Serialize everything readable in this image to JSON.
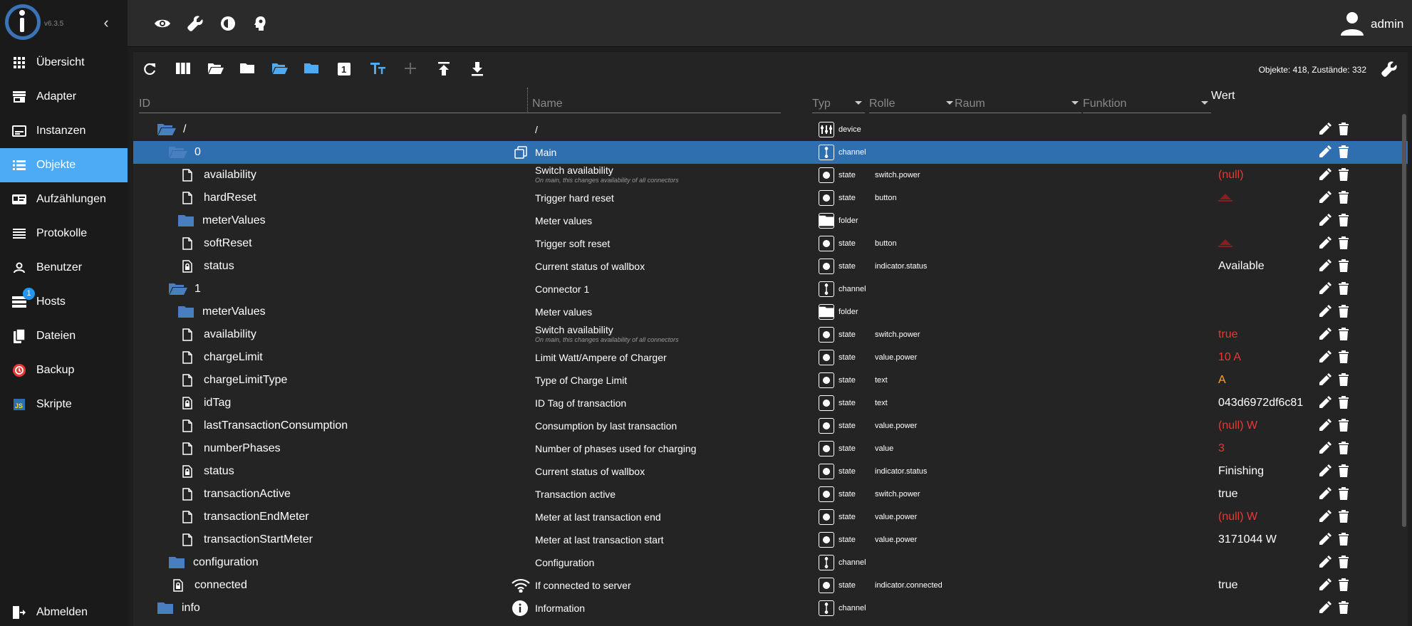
{
  "app": {
    "version": "v6.3.5"
  },
  "sidebar": {
    "items": [
      {
        "label": "Übersicht",
        "icon": "grid-icon"
      },
      {
        "label": "Adapter",
        "icon": "store-icon"
      },
      {
        "label": "Instanzen",
        "icon": "instances-icon"
      },
      {
        "label": "Objekte",
        "icon": "list-icon",
        "active": true
      },
      {
        "label": "Aufzählungen",
        "icon": "enum-icon"
      },
      {
        "label": "Protokolle",
        "icon": "log-icon"
      },
      {
        "label": "Benutzer",
        "icon": "user-icon"
      },
      {
        "label": "Hosts",
        "icon": "hosts-icon"
      },
      {
        "label": "Dateien",
        "icon": "files-icon"
      },
      {
        "label": "Backup",
        "icon": "backup-icon"
      },
      {
        "label": "Skripte",
        "icon": "js-icon"
      }
    ],
    "hosts_badge": "1",
    "logout": "Abmelden"
  },
  "topbar": {
    "user": "admin"
  },
  "toolbar": {
    "counts": "Objekte: 418, Zustände: 332"
  },
  "columns": {
    "id": "ID",
    "name": "Name",
    "typ": "Typ",
    "rolle": "Rolle",
    "raum": "Raum",
    "funktion": "Funktion",
    "wert": "Wert"
  },
  "colors": {
    "accent": "#4dabf5",
    "selected_row": "#2f6fb0",
    "folder": "#4a7fbf",
    "value_red": "#e53935",
    "value_orange": "#ffa726"
  },
  "rows": [
    {
      "id": "/",
      "kind": "folder-open",
      "indent": 0,
      "name": "/",
      "type": "device",
      "typeIcon": "device",
      "role": "",
      "value": "",
      "valueColor": "white"
    },
    {
      "id": "0",
      "kind": "folder-open",
      "indent": 1,
      "name": "Main",
      "type": "channel",
      "typeIcon": "channel",
      "role": "",
      "value": "",
      "valueColor": "white",
      "selected": true,
      "nameIcon": "copy"
    },
    {
      "id": "availability",
      "kind": "file",
      "indent": 2,
      "name": "Switch availability",
      "sub": "On main, this changes availability of all connectors",
      "type": "state",
      "typeIcon": "state",
      "role": "switch.power",
      "value": "(null)",
      "valueColor": "red"
    },
    {
      "id": "hardReset",
      "kind": "file",
      "indent": 2,
      "name": "Trigger hard reset",
      "type": "state",
      "typeIcon": "state",
      "role": "button",
      "value": "",
      "valueColor": "red",
      "button": true
    },
    {
      "id": "meterValues",
      "kind": "folder",
      "indent": 2,
      "name": "Meter values",
      "type": "folder",
      "typeIcon": "folder",
      "role": "",
      "value": "",
      "valueColor": "white"
    },
    {
      "id": "softReset",
      "kind": "file",
      "indent": 2,
      "name": "Trigger soft reset",
      "type": "state",
      "typeIcon": "state",
      "role": "button",
      "value": "",
      "valueColor": "red",
      "button": true
    },
    {
      "id": "status",
      "kind": "file-lock",
      "indent": 2,
      "name": "Current status of wallbox",
      "type": "state",
      "typeIcon": "state",
      "role": "indicator.status",
      "value": "Available",
      "valueColor": "white"
    },
    {
      "id": "1",
      "kind": "folder-open",
      "indent": 1,
      "name": "Connector 1",
      "type": "channel",
      "typeIcon": "channel",
      "role": "",
      "value": "",
      "valueColor": "white"
    },
    {
      "id": "meterValues",
      "kind": "folder",
      "indent": 2,
      "name": "Meter values",
      "type": "folder",
      "typeIcon": "folder",
      "role": "",
      "value": "",
      "valueColor": "white"
    },
    {
      "id": "availability",
      "kind": "file",
      "indent": 2,
      "name": "Switch availability",
      "sub": "On main, this changes availability of all connectors",
      "type": "state",
      "typeIcon": "state",
      "role": "switch.power",
      "value": "true",
      "valueColor": "red"
    },
    {
      "id": "chargeLimit",
      "kind": "file",
      "indent": 2,
      "name": "Limit Watt/Ampere of Charger",
      "type": "state",
      "typeIcon": "state",
      "role": "value.power",
      "value": "10 A",
      "valueColor": "red"
    },
    {
      "id": "chargeLimitType",
      "kind": "file",
      "indent": 2,
      "name": "Type of Charge Limit",
      "type": "state",
      "typeIcon": "state",
      "role": "text",
      "value": "A",
      "valueColor": "orange"
    },
    {
      "id": "idTag",
      "kind": "file-lock",
      "indent": 2,
      "name": "ID Tag of transaction",
      "type": "state",
      "typeIcon": "state",
      "role": "text",
      "value": "043d6972df6c81",
      "valueColor": "white"
    },
    {
      "id": "lastTransactionConsumption",
      "kind": "file",
      "indent": 2,
      "name": "Consumption by last transaction",
      "type": "state",
      "typeIcon": "state",
      "role": "value.power",
      "value": "(null) W",
      "valueColor": "red"
    },
    {
      "id": "numberPhases",
      "kind": "file",
      "indent": 2,
      "name": "Number of phases used for charging",
      "type": "state",
      "typeIcon": "state",
      "role": "value",
      "value": "3",
      "valueColor": "red"
    },
    {
      "id": "status",
      "kind": "file-lock",
      "indent": 2,
      "name": "Current status of wallbox",
      "type": "state",
      "typeIcon": "state",
      "role": "indicator.status",
      "value": "Finishing",
      "valueColor": "white"
    },
    {
      "id": "transactionActive",
      "kind": "file",
      "indent": 2,
      "name": "Transaction active",
      "type": "state",
      "typeIcon": "state",
      "role": "switch.power",
      "value": "true",
      "valueColor": "white"
    },
    {
      "id": "transactionEndMeter",
      "kind": "file",
      "indent": 2,
      "name": "Meter at last transaction end",
      "type": "state",
      "typeIcon": "state",
      "role": "value.power",
      "value": "(null) W",
      "valueColor": "red"
    },
    {
      "id": "transactionStartMeter",
      "kind": "file",
      "indent": 2,
      "name": "Meter at last transaction start",
      "type": "state",
      "typeIcon": "state",
      "role": "value.power",
      "value": "3171044 W",
      "valueColor": "white"
    },
    {
      "id": "configuration",
      "kind": "folder",
      "indent": 1,
      "name": "Configuration",
      "type": "channel",
      "typeIcon": "channel",
      "role": "",
      "value": "",
      "valueColor": "white"
    },
    {
      "id": "connected",
      "kind": "file-lock",
      "indent": 1,
      "name": "If connected to server",
      "type": "state",
      "typeIcon": "state",
      "role": "indicator.connected",
      "value": "true",
      "valueColor": "white",
      "nameIcon": "wifi"
    },
    {
      "id": "info",
      "kind": "folder",
      "indent": 0,
      "name": "Information",
      "type": "channel",
      "typeIcon": "channel",
      "role": "",
      "value": "",
      "valueColor": "white",
      "nameIcon": "info"
    }
  ]
}
